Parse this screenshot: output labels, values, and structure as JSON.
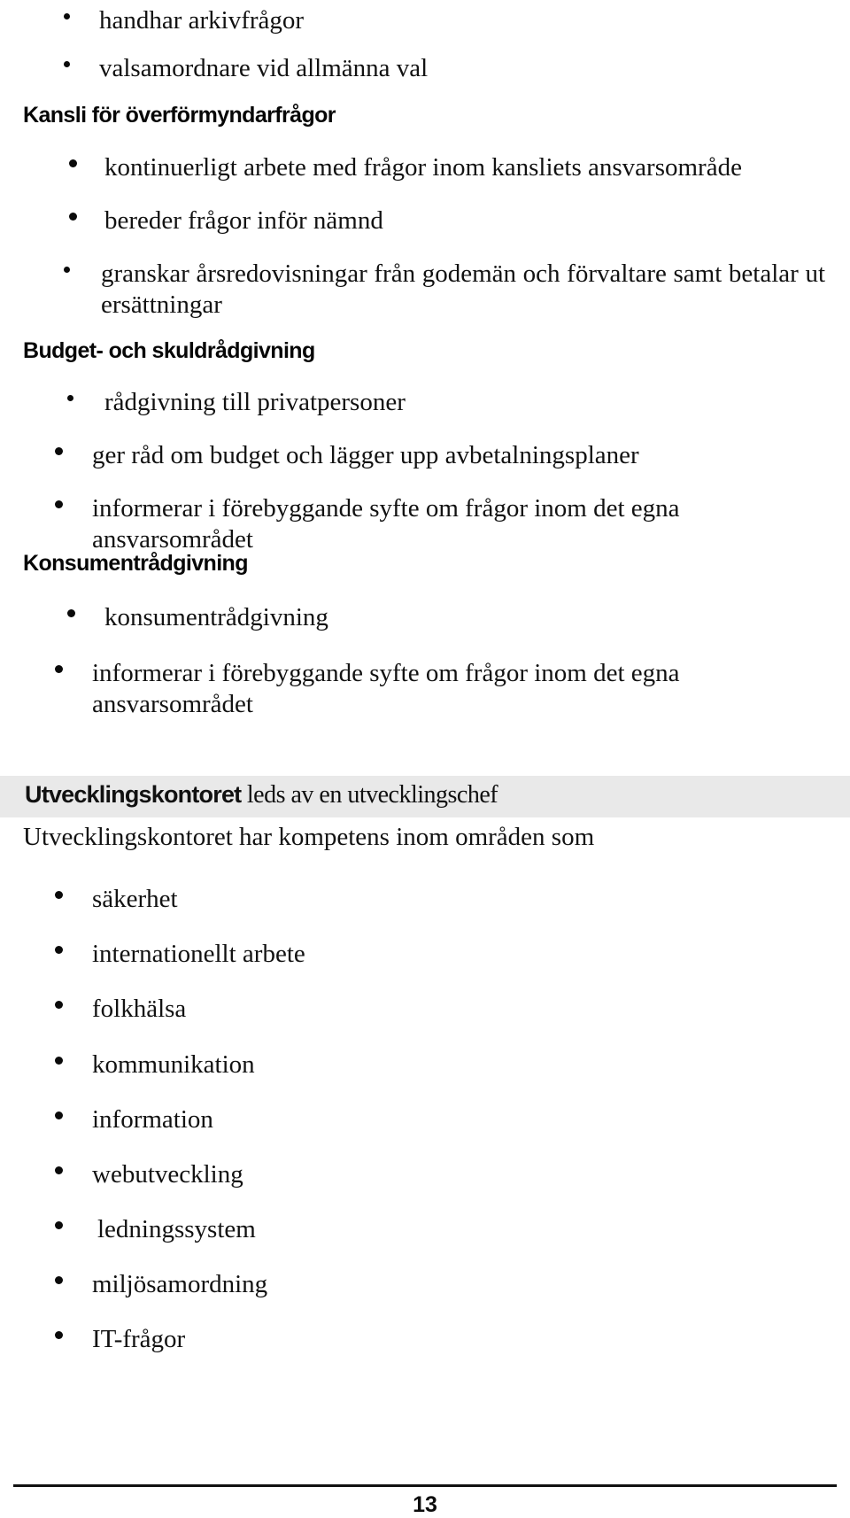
{
  "document": {
    "language": "sv",
    "page_number": "13",
    "sections": [
      {
        "id": "arkiv-val",
        "type": "bullet-list",
        "items": [
          "handhar arkivfrågor",
          "valsamordnare vid allmänna val"
        ]
      },
      {
        "id": "kansli-overformyndarfragor",
        "type": "heading-with-list",
        "heading": "Kansli för överförmyndarfrågor",
        "items": [
          "kontinuerligt arbete med frågor inom kansliets ansvarsområde",
          "bereder frågor inför nämnd",
          "granskar årsredovisningar från godemän och förvaltare samt betalar ut ersättningar"
        ]
      },
      {
        "id": "budget-och-skuldradgivning",
        "type": "heading-with-list",
        "heading": "Budget- och skuldrådgivning",
        "items": [
          "rådgivning till privatpersoner",
          "ger råd om budget och lägger upp avbetalningsplaner",
          "informerar i förebyggande syfte om frågor inom det egna ansvarsområdet"
        ]
      },
      {
        "id": "konsumentradgivning",
        "type": "heading-with-list",
        "heading": "Konsumentrådgivning",
        "items": [
          "konsumentrådgivning",
          "informerar i förebyggande syfte om frågor inom det egna ansvarsområdet"
        ]
      },
      {
        "id": "utvecklingskontoret",
        "type": "banner-with-list",
        "banner": {
          "strong": "Utvecklingskontoret",
          "rest": " leds av en utvecklingschef",
          "background_color": "#e9e9e9"
        },
        "intro": "Utvecklingskontoret har kompetens inom områden som",
        "items": [
          "säkerhet",
          "internationellt arbete",
          "folkhälsa",
          "kommunikation",
          "information",
          "webutveckling",
          "ledningssystem",
          "miljösamordning",
          "IT-frågor"
        ]
      }
    ]
  }
}
